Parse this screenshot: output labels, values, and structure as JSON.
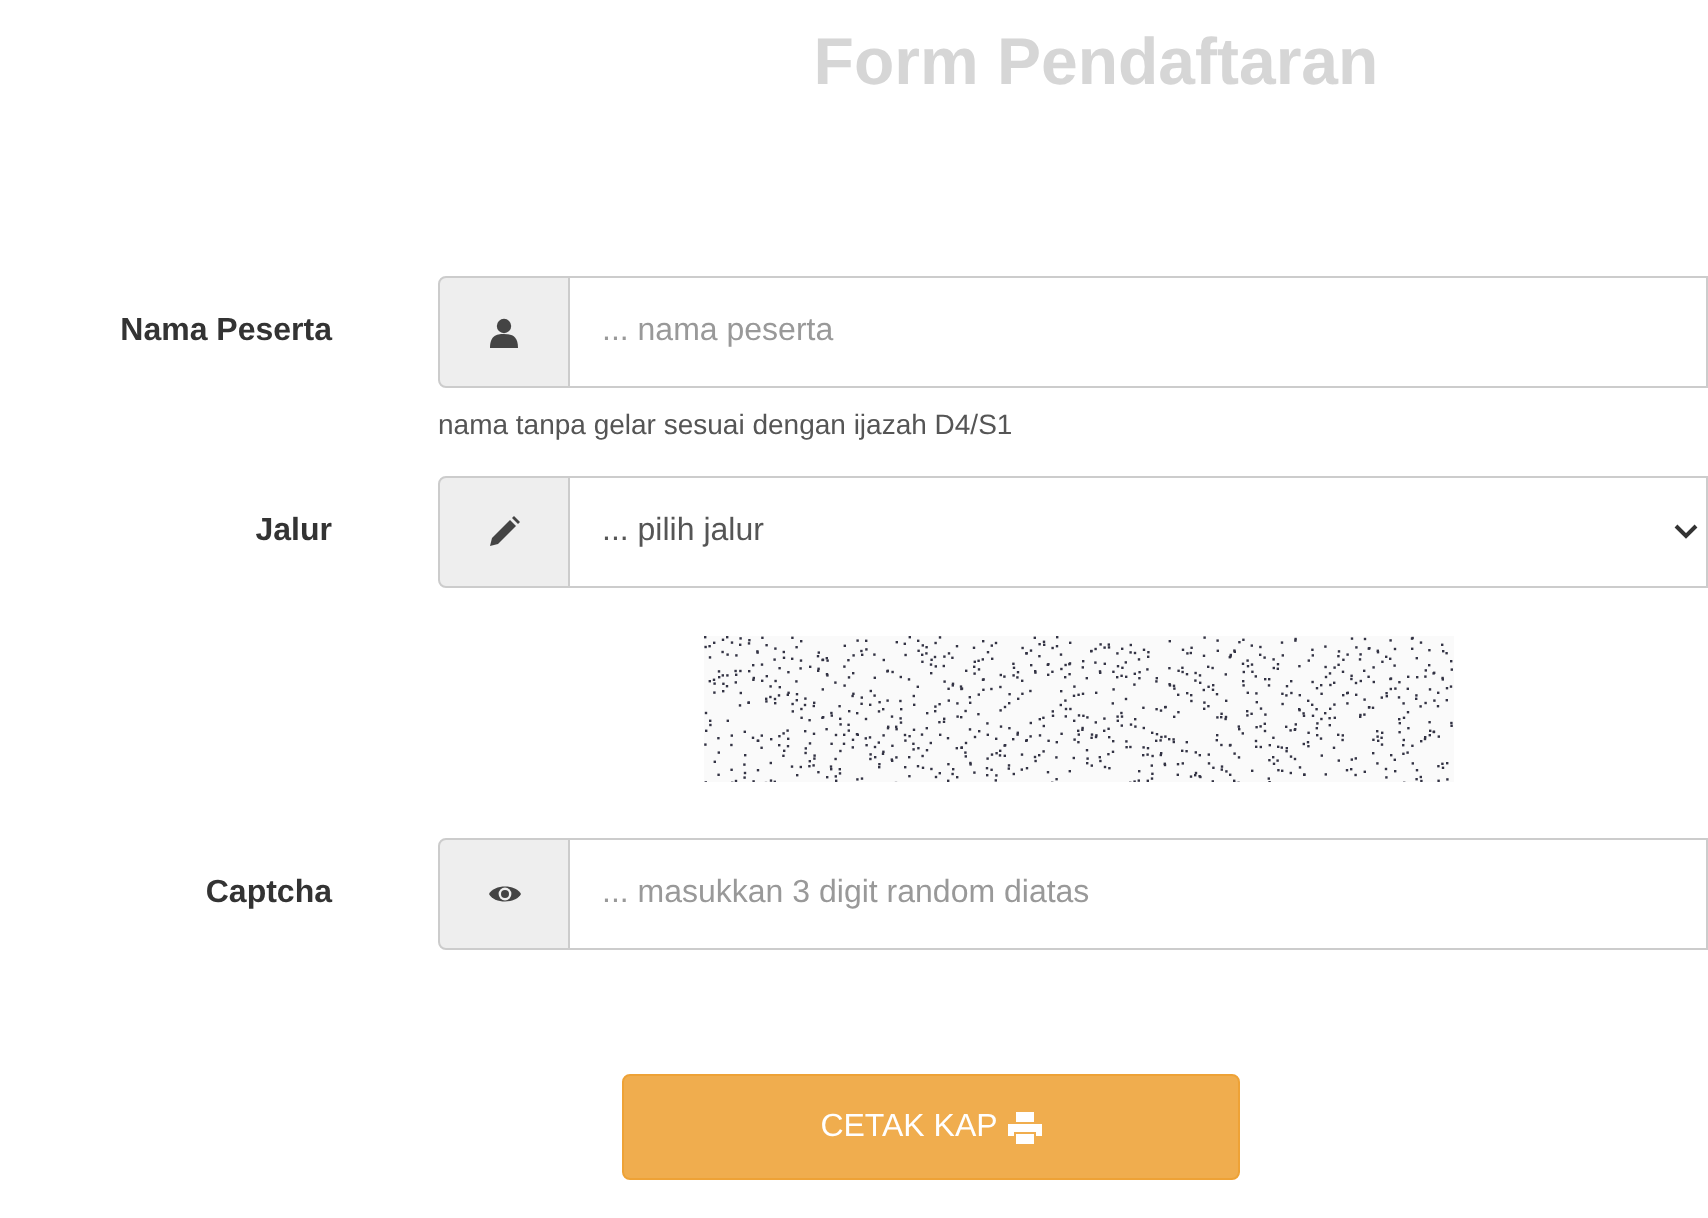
{
  "title": "Form Pendaftaran",
  "fields": [
    {
      "kind": "text",
      "label": "Nama Peserta",
      "placeholder": "... nama peserta",
      "help": "nama tanpa gelar sesuai dengan ijazah D4/S1"
    },
    {
      "kind": "select",
      "label": "Jalur",
      "value": "... pilih jalur"
    },
    {
      "kind": "image"
    },
    {
      "kind": "text",
      "label": "Captcha",
      "placeholder": "... masukkan 3 digit random diatas"
    }
  ],
  "button": {
    "label": "CETAK KAP"
  }
}
